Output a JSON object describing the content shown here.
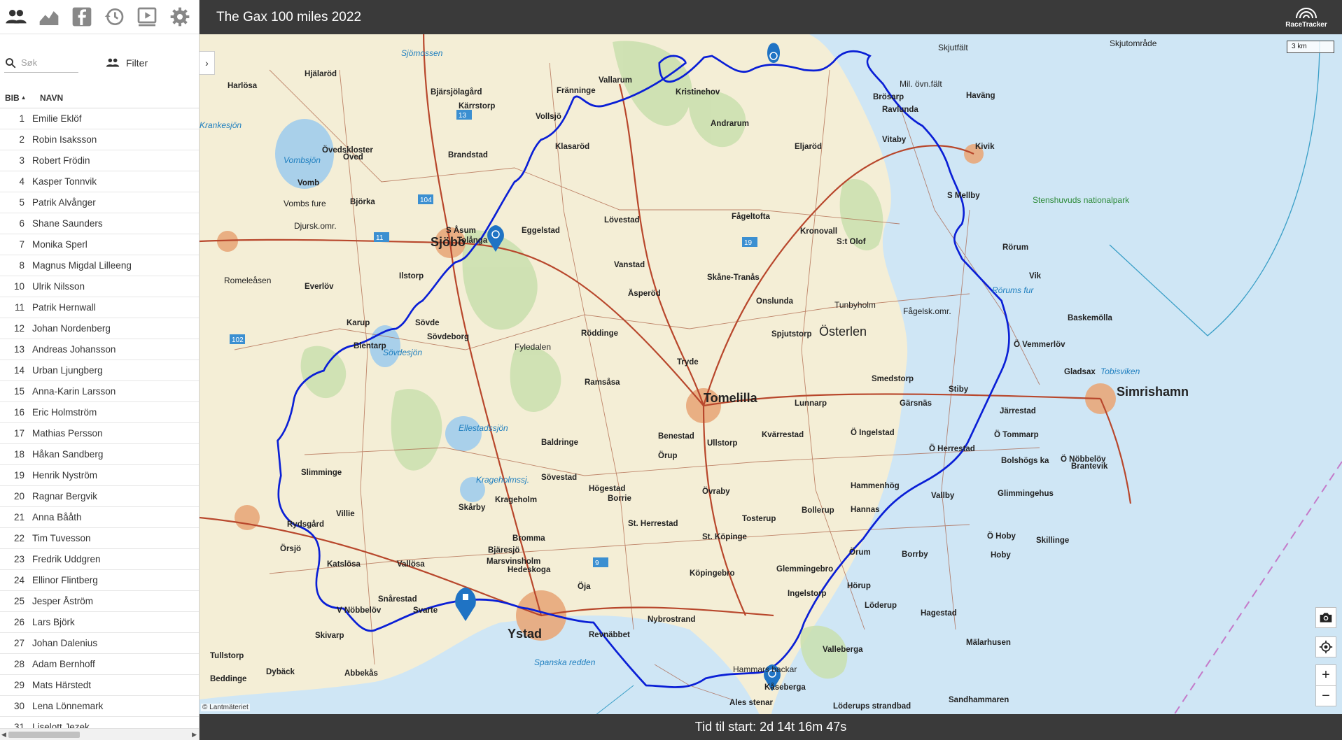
{
  "toolbar": {
    "icons": [
      "people-icon",
      "elevation-chart-icon",
      "facebook-icon",
      "history-icon",
      "video-playlist-icon",
      "settings-icon"
    ]
  },
  "search": {
    "placeholder": "Søk",
    "value": ""
  },
  "filter": {
    "label": "Filter"
  },
  "table": {
    "col_bib": "BIB",
    "col_name": "NAVN",
    "rows": [
      {
        "bib": "1",
        "name": "Emilie Eklöf"
      },
      {
        "bib": "2",
        "name": "Robin Isaksson"
      },
      {
        "bib": "3",
        "name": "Robert Frödin"
      },
      {
        "bib": "4",
        "name": "Kasper Tonnvik"
      },
      {
        "bib": "5",
        "name": "Patrik Alvånger"
      },
      {
        "bib": "6",
        "name": "Shane Saunders"
      },
      {
        "bib": "7",
        "name": "Monika Sperl"
      },
      {
        "bib": "8",
        "name": "Magnus Migdal Lilleeng"
      },
      {
        "bib": "10",
        "name": "Ulrik Nilsson"
      },
      {
        "bib": "11",
        "name": "Patrik Hernwall"
      },
      {
        "bib": "12",
        "name": "Johan Nordenberg"
      },
      {
        "bib": "13",
        "name": "Andreas Johansson"
      },
      {
        "bib": "14",
        "name": "Urban Ljungberg"
      },
      {
        "bib": "15",
        "name": "Anna-Karin Larsson"
      },
      {
        "bib": "16",
        "name": "Eric Holmström"
      },
      {
        "bib": "17",
        "name": "Mathias Persson"
      },
      {
        "bib": "18",
        "name": "Håkan Sandberg"
      },
      {
        "bib": "19",
        "name": "Henrik Nyström"
      },
      {
        "bib": "20",
        "name": "Ragnar Bergvik"
      },
      {
        "bib": "21",
        "name": "Anna Bååth"
      },
      {
        "bib": "22",
        "name": "Tim Tuvesson"
      },
      {
        "bib": "23",
        "name": "Fredrik Uddgren"
      },
      {
        "bib": "24",
        "name": "Ellinor Flintberg"
      },
      {
        "bib": "25",
        "name": "Jesper Åström"
      },
      {
        "bib": "26",
        "name": "Lars Björk"
      },
      {
        "bib": "27",
        "name": "Johan Dalenius"
      },
      {
        "bib": "28",
        "name": "Adam Bernhoff"
      },
      {
        "bib": "29",
        "name": "Mats Härstedt"
      },
      {
        "bib": "30",
        "name": "Lena Lönnemark"
      },
      {
        "bib": "31",
        "name": "Liselott Jezek"
      }
    ]
  },
  "header": {
    "title": "The Gax 100 miles 2022",
    "logo_text": "RaceTracker"
  },
  "map": {
    "scale": "3 km",
    "attribution": "© Lantmäteriet",
    "route_color": "#0a1fd6",
    "sea_color": "#cfe6f5",
    "places_major": [
      "Sjöbo",
      "Tomelilla",
      "Ystad",
      "Simrishamn"
    ],
    "places": [
      "Harlösa",
      "Hjälaröd",
      "Bjärsjölagård",
      "Vallarum",
      "Fränninge",
      "Kristinehov",
      "Brösarp",
      "Ravlunda",
      "Haväng",
      "Andrarum",
      "Eljaröd",
      "Vitaby",
      "Kivik",
      "Övedskloster",
      "Öved",
      "Brandstad",
      "Klasaröd",
      "Vollsjö",
      "Kärrstorp",
      "Vomb",
      "Björka",
      "S Åsum",
      "Tolånga",
      "Eggelstad",
      "Lövestad",
      "Fågeltofta",
      "Kronovall",
      "S:t Olof",
      "S Mellby",
      "Rörum",
      "Vik",
      "Vanstad",
      "Skåne-Tranås",
      "Äsperöd",
      "Onslunda",
      "Baskemölla",
      "Ö Vemmerlöv",
      "Everlöv",
      "Ilstorp",
      "Sövde",
      "Sövdeborg",
      "Karup",
      "Blentarp",
      "Röddinge",
      "Tryde",
      "Spjutstorp",
      "Gladsax",
      "Ramsåsa",
      "Smedstorp",
      "Gärsnäs",
      "Stiby",
      "Järrestad",
      "Lunnarp",
      "Baldringe",
      "Benestad",
      "Ullstorp",
      "Kvärrestad",
      "Ö Ingelstad",
      "Ö Herrestad",
      "Ö Tommarp",
      "Bolshögs ka",
      "Ö Nöbbelöv",
      "Brantevik",
      "Sövestad",
      "Högestad",
      "Borrie",
      "Örup",
      "Övraby",
      "Tosterup",
      "Bollerup",
      "Hannas",
      "Hammenhög",
      "Vallby",
      "Glimmingehus",
      "Slimminge",
      "Skårby",
      "Krageholm",
      "St. Herrestad",
      "St. Köpinge",
      "Ö Hoby",
      "Skillinge",
      "Villie",
      "Rydsgård",
      "Örsjö",
      "Bromma",
      "Bjäresjö",
      "Marsvinsholm",
      "Hedeskoga",
      "Köpingebro",
      "Glemmingebro",
      "Örum",
      "Borrby",
      "Hoby",
      "Katslösa",
      "Vallösa",
      "Snårestad",
      "Öja",
      "Ingelstorp",
      "Hörup",
      "Svarte",
      "V Nöbbelöv",
      "Nybrostrand",
      "Valleberga",
      "Löderup",
      "Hagestad",
      "Skivarp",
      "Abbekås",
      "Dybäck",
      "Beddinge",
      "Tullstorp",
      "Kåseberga",
      "Ales stenar",
      "Löderups strandbad",
      "Sandhammaren",
      "Mälarhusen",
      "Revnäbbet"
    ],
    "water_labels": [
      "Vombsjön",
      "Sövdesjön",
      "Ellestadssjön",
      "Krageholmssj.",
      "Tobisviken",
      "Spanska redden",
      "Rörums fur",
      "Sjömossen",
      "Krankesjön"
    ],
    "area_labels": [
      "Österlen",
      "Stenshuvuds nationalpark",
      "Romeleåsen",
      "Fyledalen",
      "Vombs fure",
      "Djursk.omr.",
      "Skjutområde",
      "Mil. övn.fält",
      "Skjutfält",
      "Fågelsk.omr.",
      "Tunbyholm",
      "Hammars backar"
    ],
    "road_numbers": [
      "13",
      "19",
      "11",
      "104",
      "102",
      "9"
    ]
  },
  "map_controls": {
    "camera": "camera-icon",
    "locate": "crosshair-icon",
    "zoom_in": "+",
    "zoom_out": "−"
  },
  "footer": {
    "countdown": "Tid til start: 2d 14t 16m 47s"
  }
}
